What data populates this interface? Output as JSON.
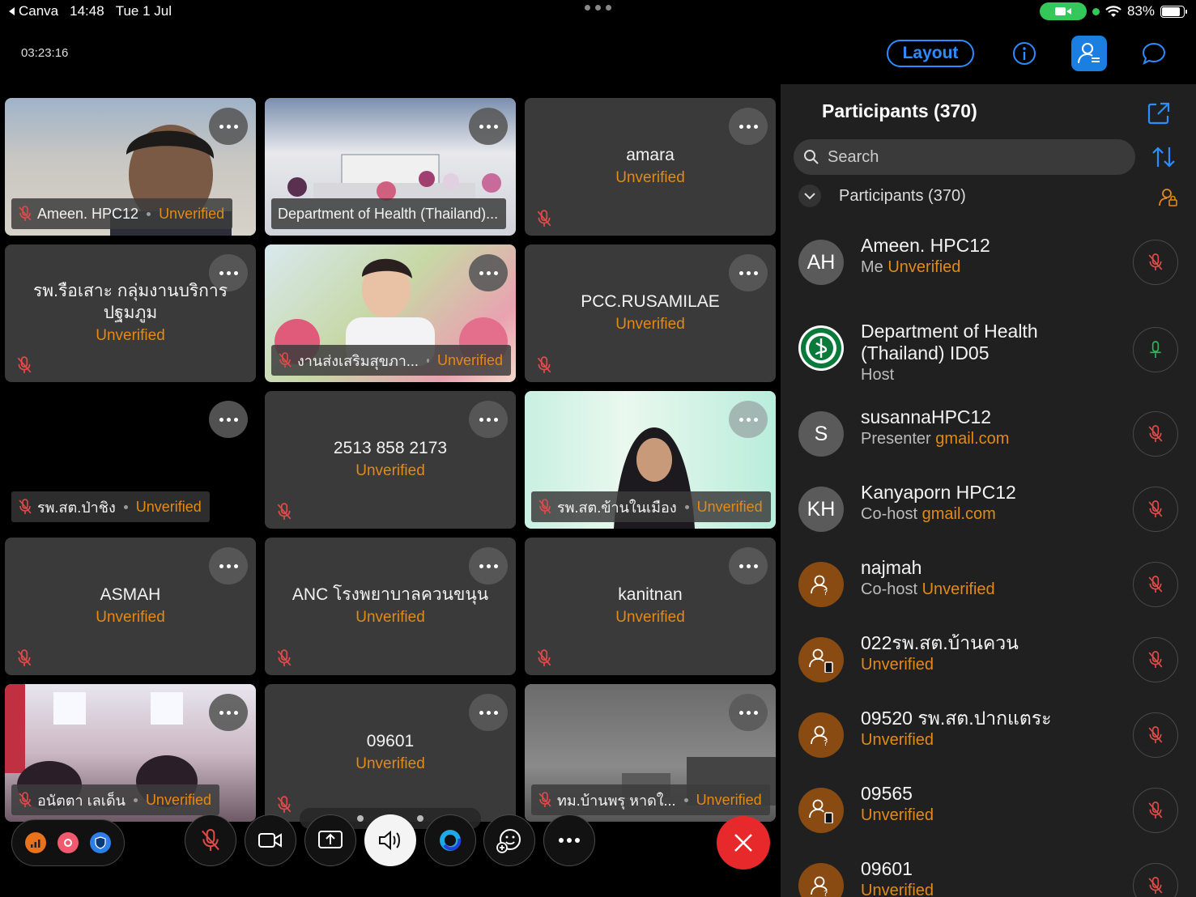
{
  "status_bar": {
    "app": "Canva",
    "time": "14:48",
    "date": "Tue 1 Jul",
    "battery": "83%"
  },
  "meeting": {
    "elapsed": "03:23:16",
    "layout_label": "Layout"
  },
  "tiles": [
    {
      "name": "Ameen. HPC12",
      "status": "Unverified"
    },
    {
      "name": "Department of Health (Thailand)...",
      "status": ""
    },
    {
      "name": "amara",
      "status": "Unverified"
    },
    {
      "name": "รพ.รือเสาะ กลุ่มงานบริการปฐมภูม",
      "status": "Unverified"
    },
    {
      "name": "งานส่งเสริมสุขภา...",
      "status": "Unverified"
    },
    {
      "name": "PCC.RUSAMILAE",
      "status": "Unverified"
    },
    {
      "name": "รพ.สต.ป่าชิง",
      "status": "Unverified"
    },
    {
      "name": "2513 858 2173",
      "status": "Unverified"
    },
    {
      "name": "รพ.สต.ข้านในเมือง",
      "status": "Unverified"
    },
    {
      "name": "ASMAH",
      "status": "Unverified"
    },
    {
      "name": "ANC โรงพยาบาลควนขนุน",
      "status": "Unverified"
    },
    {
      "name": "kanitnan",
      "status": "Unverified"
    },
    {
      "name": "อนัตตา เลเด็น",
      "status": "Unverified"
    },
    {
      "name": "09601",
      "status": "Unverified"
    },
    {
      "name": "ทม.บ้านพรุ หาดใ...",
      "status": "Unverified"
    }
  ],
  "panel": {
    "title": "Participants (370)",
    "search_placeholder": "Search",
    "section_label": "Participants (370)",
    "participants": [
      {
        "initials": "AH",
        "name": "Ameen. HPC12",
        "role": "Me",
        "tag": "Unverified",
        "mic": "muted"
      },
      {
        "initials": "",
        "name": "Department of Health (Thailand) ID05",
        "role": "Host",
        "tag": "",
        "mic": "on"
      },
      {
        "initials": "S",
        "name": "susannaHPC12",
        "role": "Presenter",
        "tag": "gmail.com",
        "mic": "muted"
      },
      {
        "initials": "KH",
        "name": "Kanyaporn HPC12",
        "role": "Co-host",
        "tag": "gmail.com",
        "mic": "muted"
      },
      {
        "initials": "",
        "name": "najmah",
        "role": "Co-host",
        "tag": "Unverified",
        "mic": "muted"
      },
      {
        "initials": "",
        "name": "022รพ.สต.บ้านควน",
        "role": "",
        "tag": "Unverified",
        "mic": "muted"
      },
      {
        "initials": "",
        "name": "09520 รพ.สต.ปากแตระ",
        "role": "",
        "tag": "Unverified",
        "mic": "muted"
      },
      {
        "initials": "",
        "name": "09565",
        "role": "",
        "tag": "Unverified",
        "mic": "muted"
      },
      {
        "initials": "",
        "name": "09601",
        "role": "",
        "tag": "Unverified",
        "mic": "muted"
      }
    ]
  },
  "colors": {
    "accent": "#2d8cff",
    "unverified": "#e38a16",
    "end_call": "#e8292c",
    "panel_bg": "#202020",
    "tile_bg": "#3a3a3a"
  }
}
